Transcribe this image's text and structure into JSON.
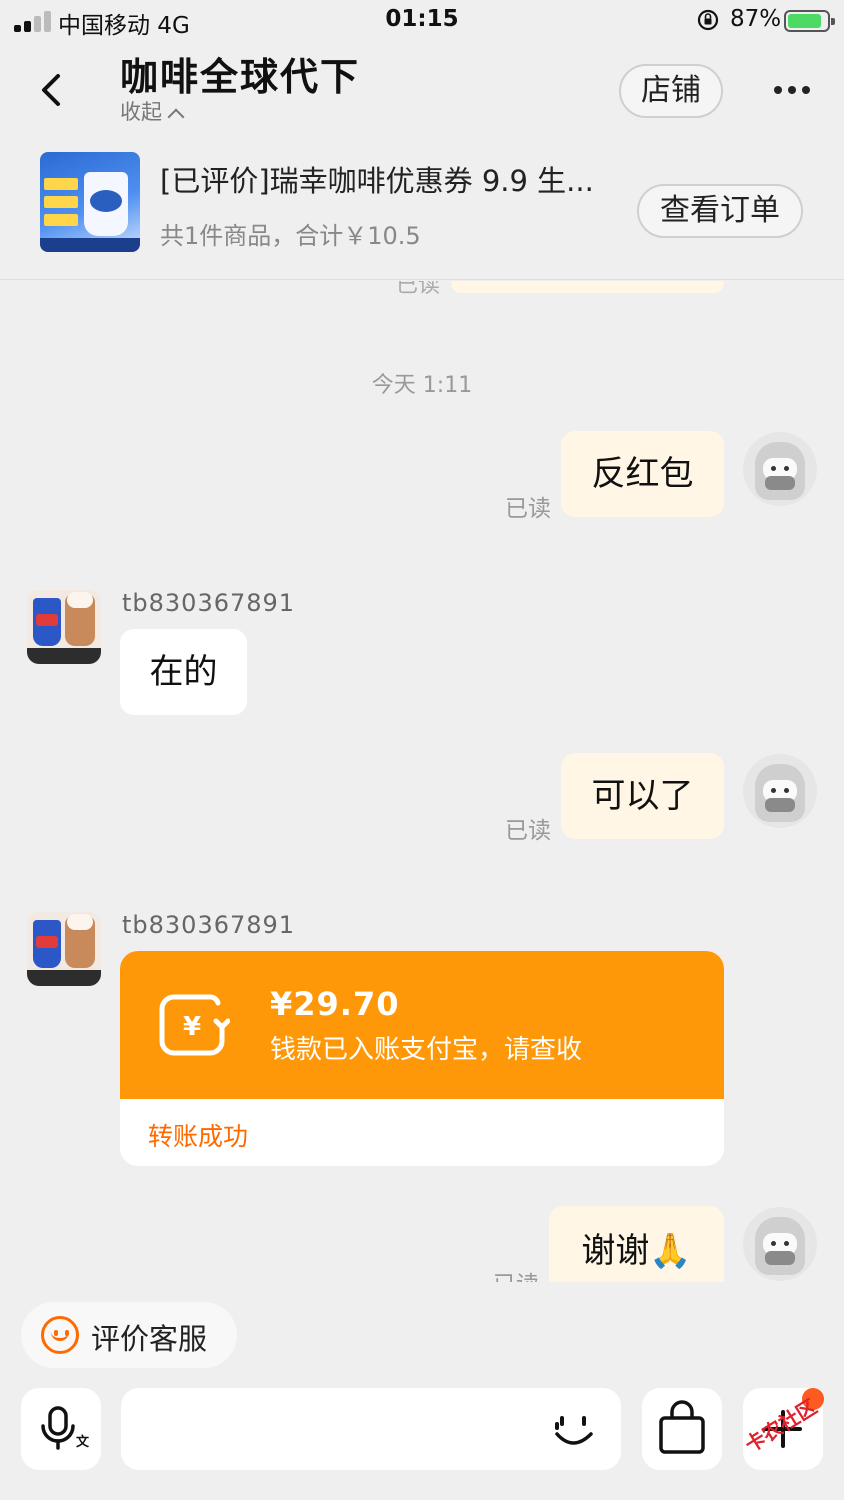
{
  "status_bar": {
    "carrier": "中国移动  4G",
    "time": "01:15",
    "battery": "87%",
    "battery_level": 0.87
  },
  "header": {
    "title": "咖啡全球代下",
    "collapse_label": "收起",
    "shop_button": "店铺"
  },
  "product": {
    "title": "[已评价]瑞幸咖啡优惠券 9.9 生...",
    "summary": "共1件商品，合计￥10.5",
    "order_button": "查看订单"
  },
  "chat": {
    "ghost_read": "已读",
    "timestamp": "今天 1:11",
    "messages": [
      {
        "from": "me",
        "text": "反红包",
        "read": "已读"
      },
      {
        "from": "shop",
        "nick": "tb830367891",
        "text": "在的"
      },
      {
        "from": "me",
        "text": "可以了",
        "read": "已读"
      },
      {
        "from": "shop",
        "nick": "tb830367891"
      },
      {
        "from": "me",
        "text": "谢谢🙏",
        "read": "已读"
      }
    ],
    "transfer": {
      "amount": "¥29.70",
      "description": "钱款已入账支付宝，请查收",
      "status": "转账成功"
    }
  },
  "bottom": {
    "rate_label": "评价客服",
    "watermark": "卡农社区"
  },
  "colors": {
    "accent": "#ff9808",
    "bubble_out": "#fff6e6",
    "status_text": "#ff6a00"
  }
}
